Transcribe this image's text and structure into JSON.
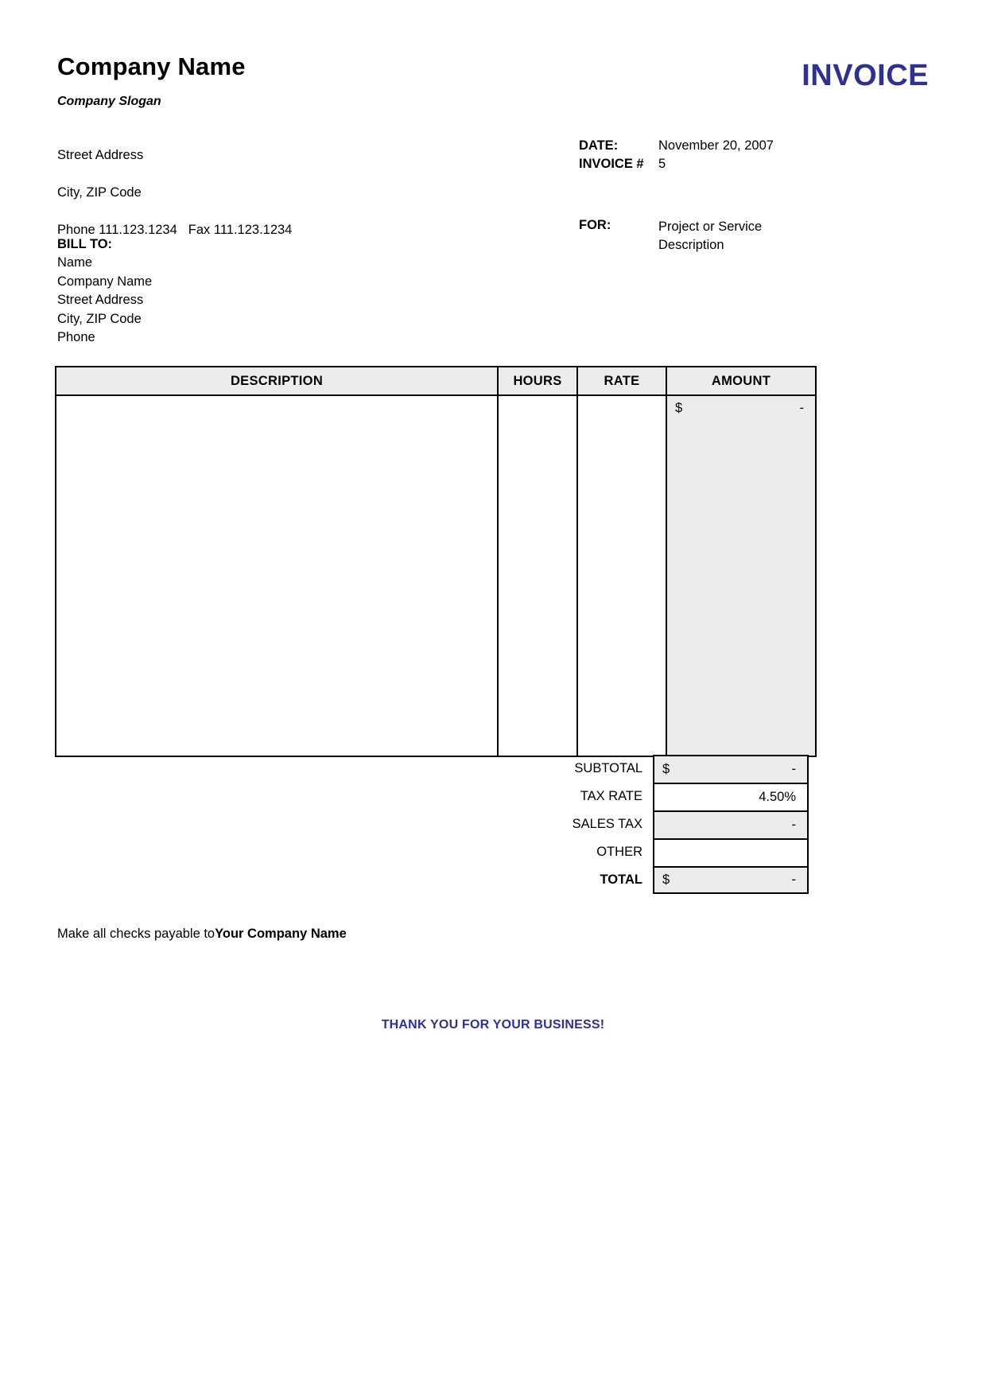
{
  "colors": {
    "accent": "#2e3192",
    "header_fill": "#ececec",
    "amount_fill": "#ececec",
    "border": "#000000",
    "text": "#000000"
  },
  "header": {
    "company_name": "Company Name",
    "company_slogan": "Company Slogan",
    "street_address": "Street Address",
    "city_zip": "City, ZIP Code",
    "phone_label": "Phone 111.123.1234",
    "fax_label": "Fax 111.123.1234",
    "invoice_title": "INVOICE"
  },
  "meta": {
    "date_label": "DATE:",
    "date_value": "November 20, 2007",
    "invoice_no_label": "INVOICE #",
    "invoice_no_value": "5",
    "for_label": "FOR:",
    "for_value_line1": "Project or Service",
    "for_value_line2": "Description"
  },
  "bill_to": {
    "label": "BILL TO:",
    "name": "Name",
    "company": "Company Name",
    "street": "Street Address",
    "city_zip": "City, ZIP Code",
    "phone": "Phone"
  },
  "table": {
    "columns": [
      "DESCRIPTION",
      "HOURS",
      "RATE",
      "AMOUNT"
    ],
    "rows": [],
    "amount_currency": "$",
    "amount_value": "-"
  },
  "totals": [
    {
      "label": "SUBTOTAL",
      "currency": "$",
      "value": "-",
      "filled": true,
      "bold": false
    },
    {
      "label": "TAX RATE",
      "currency": "",
      "value": "4.50%",
      "filled": false,
      "bold": false
    },
    {
      "label": "SALES TAX",
      "currency": "",
      "value": "-",
      "filled": true,
      "bold": false
    },
    {
      "label": "OTHER",
      "currency": "",
      "value": "",
      "filled": false,
      "bold": false
    },
    {
      "label": "TOTAL",
      "currency": "$",
      "value": "-",
      "filled": true,
      "bold": true
    }
  ],
  "footer": {
    "payable_prefix": "Make all checks payable to",
    "payable_company": "Your Company Name",
    "thank_you": "THANK YOU FOR YOUR BUSINESS!"
  }
}
